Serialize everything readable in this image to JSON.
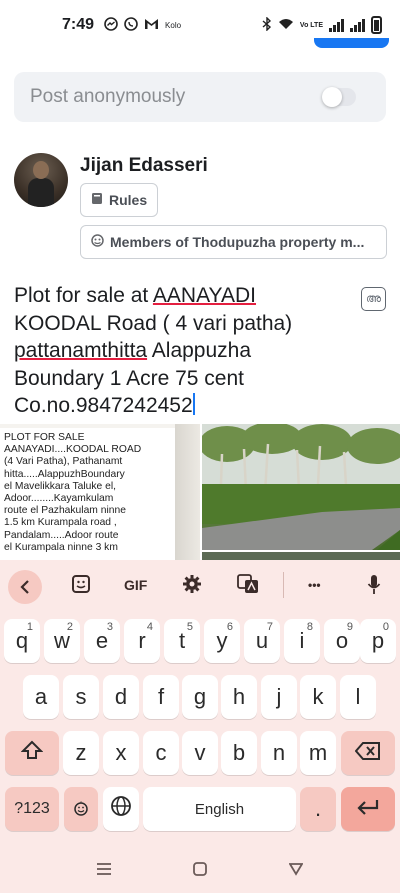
{
  "status_bar": {
    "time": "7:49",
    "carrier_label": "Kolo",
    "network_label": "Vo LTE"
  },
  "composer": {
    "anon_label": "Post anonymously",
    "anon_toggle_on": false
  },
  "author": {
    "name": "Jijan Edasseri",
    "rules_label": "Rules",
    "group_label": "Members of Thodupuzha property m..."
  },
  "post": {
    "line1_a": "Plot for sale at ",
    "line1_b": "AANAYADI",
    "line2_a": "KOODAL",
    "line2_b": " Road ( 4 vari patha)",
    "line3_a": "pattanamthitta",
    "line3_b": " Alappuzha",
    "line4": "Boundary 1 Acre 75 cent",
    "line5": "Co.no.9847242452",
    "translate_icon_text": "അ"
  },
  "image_doc": {
    "lines": [
      "PLOT FOR SALE",
      "AANAYADI....KOODAL ROAD",
      "(4 Vari Patha), Pathanamt",
      "hitta.....AlappuzhBoundary",
      "el Mavelikkara Taluke  el,",
      "Adoor........Kayamkulam",
      "route el Pazhakulam ninne",
      "1.5 km Kurampala  road ,",
      "Pandalam.....Adoor  route",
      "el Kurampala  ninne 3 km"
    ]
  },
  "keyboard": {
    "toolbar": {
      "gif_label": "GIF",
      "more_label": "•••"
    },
    "row1": [
      "q",
      "w",
      "e",
      "r",
      "t",
      "y",
      "u",
      "i",
      "o",
      "p"
    ],
    "row1_hints": [
      "1",
      "2",
      "3",
      "4",
      "5",
      "6",
      "7",
      "8",
      "9",
      "0"
    ],
    "row2": [
      "a",
      "s",
      "d",
      "f",
      "g",
      "h",
      "j",
      "k",
      "l"
    ],
    "row3": [
      "z",
      "x",
      "c",
      "v",
      "b",
      "n",
      "m"
    ],
    "symbols_label": "?123",
    "space_label": "English",
    "period_label": ".",
    "comma_label": ","
  },
  "colors": {
    "accent": "#1877f2",
    "keyboard_bg": "#fbe9e7",
    "func_key": "#f6c9c2",
    "spellcheck": "#e41e3f"
  }
}
